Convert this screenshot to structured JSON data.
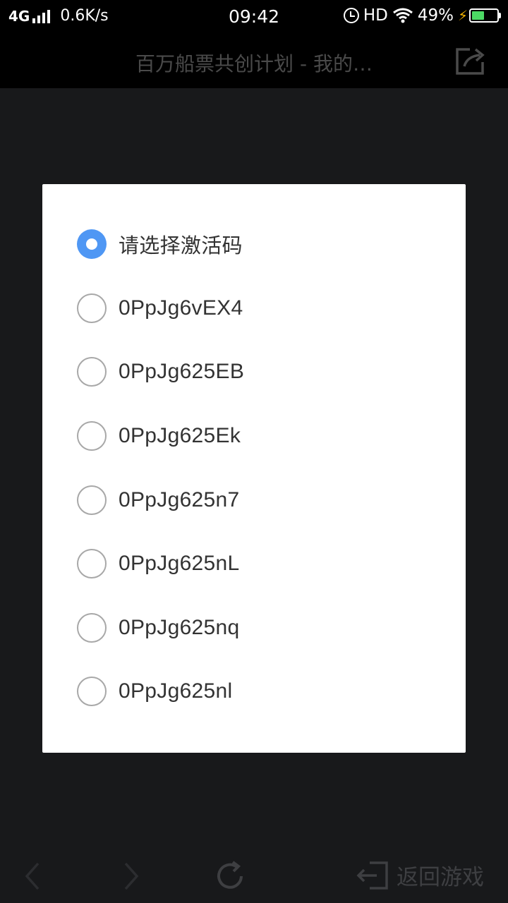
{
  "status_bar": {
    "network": "4G",
    "speed": "0.6K/s",
    "time": "09:42",
    "hd": "HD",
    "battery_pct": "49%",
    "battery_level": 0.49
  },
  "header": {
    "title": "百万船票共创计划 - 我的…"
  },
  "dialog": {
    "options": [
      {
        "label": "请选择激活码",
        "checked": true
      },
      {
        "label": "0PpJg6vEX4",
        "checked": false
      },
      {
        "label": "0PpJg625EB",
        "checked": false
      },
      {
        "label": "0PpJg625Ek",
        "checked": false
      },
      {
        "label": "0PpJg625n7",
        "checked": false
      },
      {
        "label": "0PpJg625nL",
        "checked": false
      },
      {
        "label": "0PpJg625nq",
        "checked": false
      },
      {
        "label": "0PpJg625nl",
        "checked": false
      }
    ]
  },
  "toolbar": {
    "back_game_label": "返回游戏"
  },
  "colors": {
    "accent": "#4f97f4",
    "background": "#18191b",
    "bar": "#000000"
  },
  "icons": [
    "signal-icon",
    "alarm-icon",
    "wifi-icon",
    "charging-icon",
    "battery-icon",
    "share-icon",
    "back-arrow-icon",
    "forward-arrow-icon",
    "refresh-icon",
    "exit-icon"
  ]
}
